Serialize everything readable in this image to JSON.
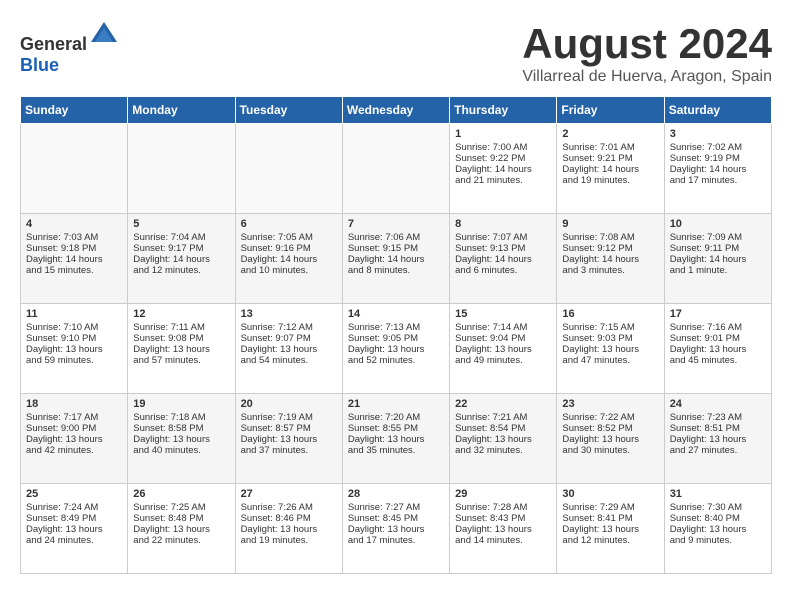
{
  "header": {
    "logo_general": "General",
    "logo_blue": "Blue",
    "title": "August 2024",
    "subtitle": "Villarreal de Huerva, Aragon, Spain"
  },
  "days_of_week": [
    "Sunday",
    "Monday",
    "Tuesday",
    "Wednesday",
    "Thursday",
    "Friday",
    "Saturday"
  ],
  "weeks": [
    [
      {
        "day": "",
        "content": ""
      },
      {
        "day": "",
        "content": ""
      },
      {
        "day": "",
        "content": ""
      },
      {
        "day": "",
        "content": ""
      },
      {
        "day": "1",
        "content": "Sunrise: 7:00 AM\nSunset: 9:22 PM\nDaylight: 14 hours\nand 21 minutes."
      },
      {
        "day": "2",
        "content": "Sunrise: 7:01 AM\nSunset: 9:21 PM\nDaylight: 14 hours\nand 19 minutes."
      },
      {
        "day": "3",
        "content": "Sunrise: 7:02 AM\nSunset: 9:19 PM\nDaylight: 14 hours\nand 17 minutes."
      }
    ],
    [
      {
        "day": "4",
        "content": "Sunrise: 7:03 AM\nSunset: 9:18 PM\nDaylight: 14 hours\nand 15 minutes."
      },
      {
        "day": "5",
        "content": "Sunrise: 7:04 AM\nSunset: 9:17 PM\nDaylight: 14 hours\nand 12 minutes."
      },
      {
        "day": "6",
        "content": "Sunrise: 7:05 AM\nSunset: 9:16 PM\nDaylight: 14 hours\nand 10 minutes."
      },
      {
        "day": "7",
        "content": "Sunrise: 7:06 AM\nSunset: 9:15 PM\nDaylight: 14 hours\nand 8 minutes."
      },
      {
        "day": "8",
        "content": "Sunrise: 7:07 AM\nSunset: 9:13 PM\nDaylight: 14 hours\nand 6 minutes."
      },
      {
        "day": "9",
        "content": "Sunrise: 7:08 AM\nSunset: 9:12 PM\nDaylight: 14 hours\nand 3 minutes."
      },
      {
        "day": "10",
        "content": "Sunrise: 7:09 AM\nSunset: 9:11 PM\nDaylight: 14 hours\nand 1 minute."
      }
    ],
    [
      {
        "day": "11",
        "content": "Sunrise: 7:10 AM\nSunset: 9:10 PM\nDaylight: 13 hours\nand 59 minutes."
      },
      {
        "day": "12",
        "content": "Sunrise: 7:11 AM\nSunset: 9:08 PM\nDaylight: 13 hours\nand 57 minutes."
      },
      {
        "day": "13",
        "content": "Sunrise: 7:12 AM\nSunset: 9:07 PM\nDaylight: 13 hours\nand 54 minutes."
      },
      {
        "day": "14",
        "content": "Sunrise: 7:13 AM\nSunset: 9:05 PM\nDaylight: 13 hours\nand 52 minutes."
      },
      {
        "day": "15",
        "content": "Sunrise: 7:14 AM\nSunset: 9:04 PM\nDaylight: 13 hours\nand 49 minutes."
      },
      {
        "day": "16",
        "content": "Sunrise: 7:15 AM\nSunset: 9:03 PM\nDaylight: 13 hours\nand 47 minutes."
      },
      {
        "day": "17",
        "content": "Sunrise: 7:16 AM\nSunset: 9:01 PM\nDaylight: 13 hours\nand 45 minutes."
      }
    ],
    [
      {
        "day": "18",
        "content": "Sunrise: 7:17 AM\nSunset: 9:00 PM\nDaylight: 13 hours\nand 42 minutes."
      },
      {
        "day": "19",
        "content": "Sunrise: 7:18 AM\nSunset: 8:58 PM\nDaylight: 13 hours\nand 40 minutes."
      },
      {
        "day": "20",
        "content": "Sunrise: 7:19 AM\nSunset: 8:57 PM\nDaylight: 13 hours\nand 37 minutes."
      },
      {
        "day": "21",
        "content": "Sunrise: 7:20 AM\nSunset: 8:55 PM\nDaylight: 13 hours\nand 35 minutes."
      },
      {
        "day": "22",
        "content": "Sunrise: 7:21 AM\nSunset: 8:54 PM\nDaylight: 13 hours\nand 32 minutes."
      },
      {
        "day": "23",
        "content": "Sunrise: 7:22 AM\nSunset: 8:52 PM\nDaylight: 13 hours\nand 30 minutes."
      },
      {
        "day": "24",
        "content": "Sunrise: 7:23 AM\nSunset: 8:51 PM\nDaylight: 13 hours\nand 27 minutes."
      }
    ],
    [
      {
        "day": "25",
        "content": "Sunrise: 7:24 AM\nSunset: 8:49 PM\nDaylight: 13 hours\nand 24 minutes."
      },
      {
        "day": "26",
        "content": "Sunrise: 7:25 AM\nSunset: 8:48 PM\nDaylight: 13 hours\nand 22 minutes."
      },
      {
        "day": "27",
        "content": "Sunrise: 7:26 AM\nSunset: 8:46 PM\nDaylight: 13 hours\nand 19 minutes."
      },
      {
        "day": "28",
        "content": "Sunrise: 7:27 AM\nSunset: 8:45 PM\nDaylight: 13 hours\nand 17 minutes."
      },
      {
        "day": "29",
        "content": "Sunrise: 7:28 AM\nSunset: 8:43 PM\nDaylight: 13 hours\nand 14 minutes."
      },
      {
        "day": "30",
        "content": "Sunrise: 7:29 AM\nSunset: 8:41 PM\nDaylight: 13 hours\nand 12 minutes."
      },
      {
        "day": "31",
        "content": "Sunrise: 7:30 AM\nSunset: 8:40 PM\nDaylight: 13 hours\nand 9 minutes."
      }
    ]
  ]
}
